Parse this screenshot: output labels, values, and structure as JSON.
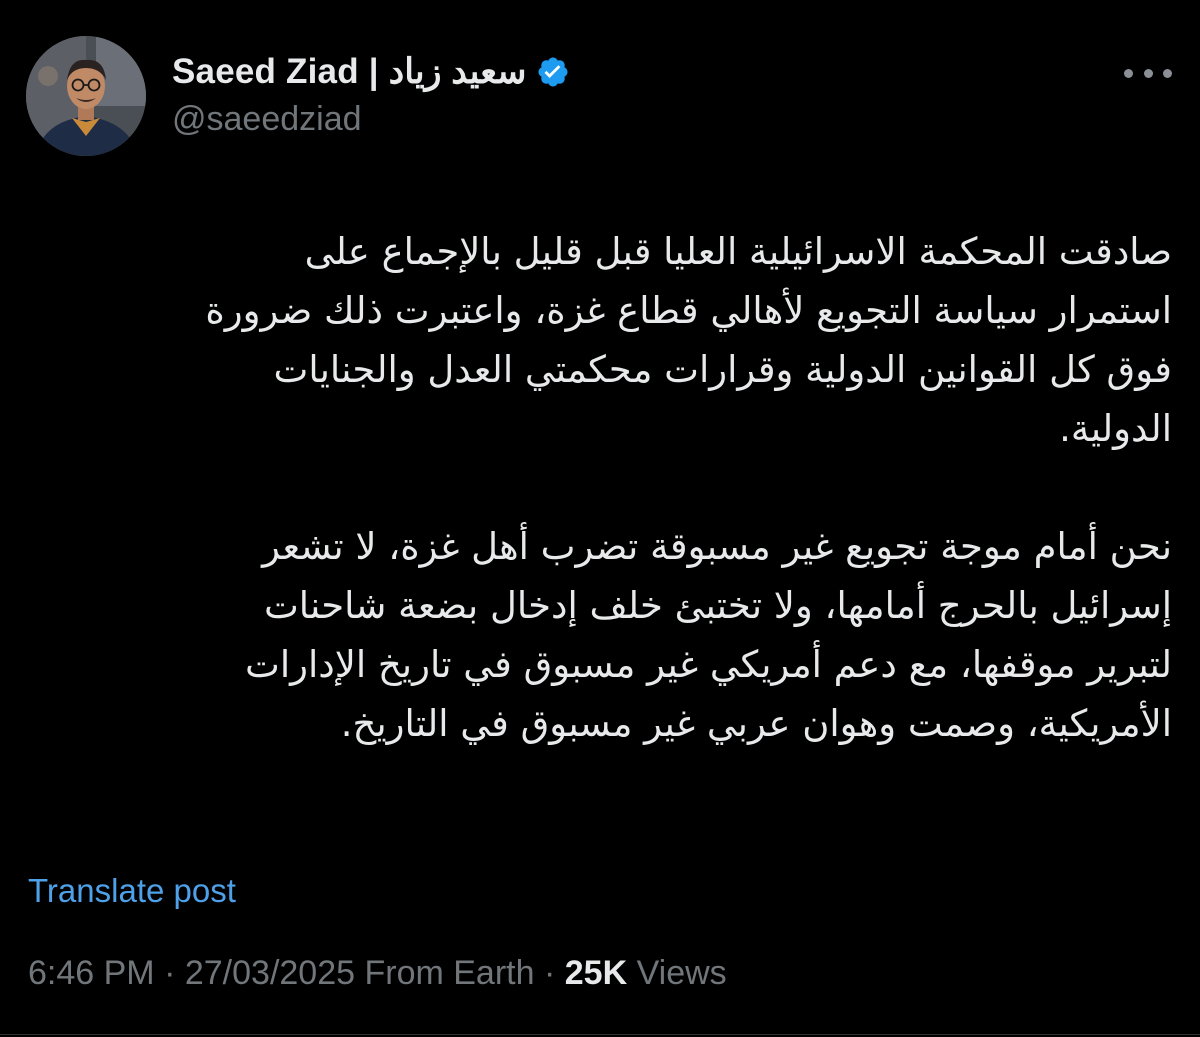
{
  "author": {
    "display_name": "Saeed Ziad | سعيد زياد",
    "handle": "@saeedziad",
    "verified": true
  },
  "more_icon": "more-horizontal-icon",
  "post": {
    "paragraphs": [
      {
        "lines": [
          "صادقت المحكمة الاسرائيلية العليا قبل قليل بالإجماع على",
          "استمرار سياسة التجويع لأهالي قطاع غزة، واعتبرت ذلك ضرورة",
          "فوق كل القوانين الدولية وقرارات محكمتي العدل والجنايات",
          "الدولية."
        ]
      },
      {
        "lines": [
          "نحن أمام موجة تجويع غير مسبوقة تضرب أهل غزة، لا تشعر",
          "إسرائيل بالحرج أمامها، ولا تختبئ خلف إدخال بضعة شاحنات",
          "لتبرير موقفها، مع دعم أمريكي غير مسبوق في تاريخ الإدارات",
          "الأمريكية، وصمت وهوان عربي غير مسبوق في التاريخ."
        ]
      }
    ],
    "translate_label": "Translate post",
    "time": "6:46 PM",
    "date": "27/03/2025",
    "source": "From Earth",
    "separator": "·",
    "views_count": "25K",
    "views_label": "Views"
  },
  "colors": {
    "background": "#000000",
    "primary_text": "#e7e9ea",
    "secondary_text": "#71767b",
    "link": "#4ea1e8",
    "verified_badge": "#1d9bf0"
  }
}
